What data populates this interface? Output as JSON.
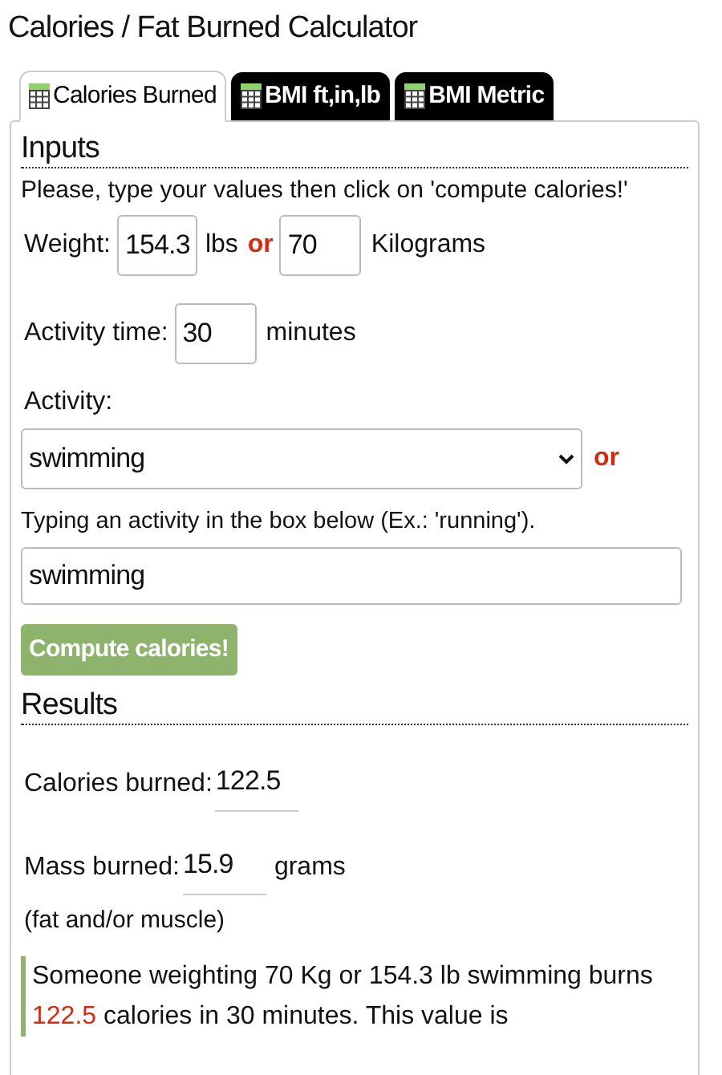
{
  "title": "Calories / Fat Burned Calculator",
  "tabs": [
    {
      "label": "Calories Burned",
      "selected": true
    },
    {
      "label": "BMI ft,in,lb",
      "selected": false
    },
    {
      "label": "BMI Metric",
      "selected": false
    }
  ],
  "inputs": {
    "heading": "Inputs",
    "instructions": "Please, type your values then click on 'compute calories!'",
    "weight_label": "Weight:",
    "pounds": "154.3",
    "pounds_unit": "lbs",
    "or": "or",
    "kilograms": "70",
    "kilograms_unit": "Kilograms",
    "time_label": "Activity time:",
    "time": "30",
    "time_unit": "minutes",
    "activity_label": "Activity:",
    "activity_select": "swimming",
    "select_or": "or",
    "typing_hint": "Typing an activity in the box below (Ex.: 'running').",
    "activity_text": "swimming",
    "compute_button": "Compute calories!"
  },
  "results": {
    "heading": "Results",
    "calories_label": "Calories burned:",
    "calories": "122.5",
    "mass_label": "Mass burned:",
    "mass": "15.9",
    "mass_unit": "grams",
    "mass_note": "(fat and/or muscle)",
    "summary": {
      "before": "Someone weighting 70 Kg or 154.3 lb swimming burns ",
      "value": "122.5",
      "after": " calories in 30 minutes. This value is"
    }
  }
}
